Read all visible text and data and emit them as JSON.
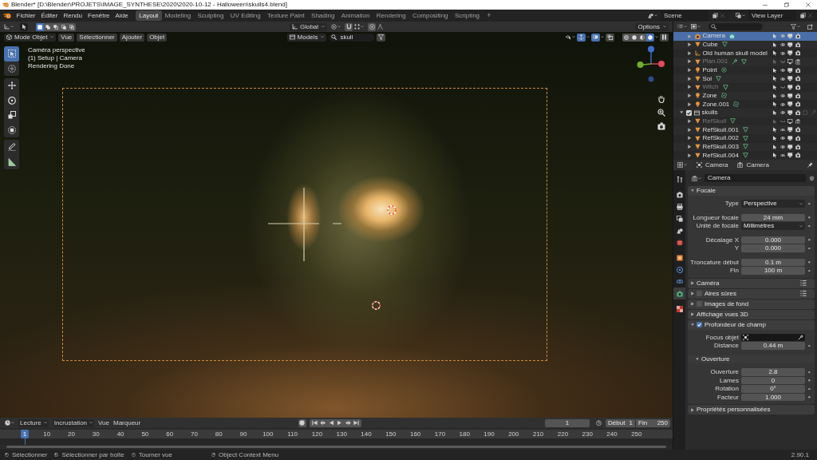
{
  "window": {
    "title": "Blender* [D:\\Blender\\PROJETS\\IMAGE_SYNTHESE\\2020\\2020-10-12 - Halloween\\skulls4.blend]"
  },
  "topbar": {
    "menus": [
      "Fichier",
      "Éditer",
      "Rendu",
      "Fenêtre",
      "Aide"
    ],
    "workspaces": [
      {
        "label": "Layout",
        "selected": true
      },
      {
        "label": "Modeling",
        "selected": false
      },
      {
        "label": "Sculpting",
        "selected": false
      },
      {
        "label": "UV Editing",
        "selected": false
      },
      {
        "label": "Texture Paint",
        "selected": false
      },
      {
        "label": "Shading",
        "selected": false
      },
      {
        "label": "Animation",
        "selected": false
      },
      {
        "label": "Rendering",
        "selected": false
      },
      {
        "label": "Compositing",
        "selected": false
      },
      {
        "label": "Scripting",
        "selected": false
      }
    ],
    "add_workspace": "+",
    "scene": "Scene",
    "view_layer": "View Layer"
  },
  "viewport": {
    "select_modes": [
      {
        "selected": true
      },
      {
        "selected": false
      },
      {
        "selected": false
      },
      {
        "selected": false
      },
      {
        "selected": false
      }
    ],
    "orientation": "Global",
    "options": "Options",
    "mode": "Mode Objet",
    "menus": [
      "Vue",
      "Sélectionner",
      "Ajouter",
      "Objet"
    ],
    "collection": "Models",
    "search": "skull",
    "toggles": [
      {
        "kind": "gizmo",
        "on": true
      },
      {
        "kind": "overlay",
        "on": true
      },
      {
        "kind": "xray",
        "on": false
      }
    ],
    "shading": [
      {
        "kind": "wireframe",
        "selected": false
      },
      {
        "kind": "solid",
        "selected": false
      },
      {
        "kind": "material",
        "selected": false
      },
      {
        "kind": "rendered",
        "selected": true
      }
    ],
    "info": [
      "Caméra perspective",
      "(1) Setup | Camera",
      "Rendering Done"
    ],
    "tool_groups": [
      [
        {
          "kind": "select",
          "selected": true
        },
        {
          "kind": "cursor",
          "selected": false
        }
      ],
      [
        {
          "kind": "move",
          "selected": false
        },
        {
          "kind": "rotate",
          "selected": false
        },
        {
          "kind": "scale",
          "selected": false
        },
        {
          "kind": "transform",
          "selected": false
        }
      ],
      [
        {
          "kind": "annotate",
          "selected": false
        },
        {
          "kind": "measure",
          "selected": false
        }
      ]
    ]
  },
  "outliner": {
    "objects": [
      {
        "name": "Camera",
        "kind": "camera",
        "selected": true,
        "expanded": false,
        "visible": true,
        "viewport": true,
        "render": true,
        "modifier": false
      },
      {
        "name": "Cube",
        "kind": "mesh",
        "selected": false,
        "expanded": false,
        "visible": true,
        "viewport": true,
        "render": true,
        "modifier": false
      },
      {
        "name": "Old human skull model",
        "kind": "empty",
        "selected": false,
        "expanded": false,
        "visible": true,
        "viewport": true,
        "render": true,
        "modifier": false
      },
      {
        "name": "Plan.001",
        "kind": "mesh",
        "selected": false,
        "expanded": false,
        "visible": false,
        "viewport": false,
        "render": false,
        "modifier": true
      },
      {
        "name": "Point",
        "kind": "point_light",
        "selected": false,
        "expanded": false,
        "visible": true,
        "viewport": true,
        "render": true,
        "modifier": false
      },
      {
        "name": "Sol",
        "kind": "mesh",
        "selected": false,
        "expanded": false,
        "visible": true,
        "viewport": true,
        "render": true,
        "modifier": false
      },
      {
        "name": "Witch",
        "kind": "mesh",
        "selected": false,
        "expanded": false,
        "visible": false,
        "viewport": true,
        "render": true,
        "modifier": false
      },
      {
        "name": "Zone",
        "kind": "area_light",
        "selected": false,
        "expanded": false,
        "visible": true,
        "viewport": true,
        "render": true,
        "modifier": false
      },
      {
        "name": "Zone.001",
        "kind": "area_light",
        "selected": false,
        "expanded": false,
        "visible": true,
        "viewport": true,
        "render": true,
        "modifier": false
      }
    ],
    "collections": [
      {
        "name": "skulls",
        "kind": "collection",
        "checked": true,
        "selected": false,
        "expanded": true,
        "visible": true,
        "viewport": true,
        "render": true,
        "children": [
          {
            "name": "RefSkull",
            "kind": "mesh",
            "selected": false,
            "expanded": false,
            "visible": false,
            "viewport": false,
            "render": false,
            "modifier": false
          },
          {
            "name": "RefSkull.001",
            "kind": "mesh",
            "selected": false,
            "expanded": false,
            "visible": true,
            "viewport": true,
            "render": true,
            "modifier": false
          },
          {
            "name": "RefSkull.002",
            "kind": "mesh",
            "selected": false,
            "expanded": false,
            "visible": true,
            "viewport": true,
            "render": true,
            "modifier": false
          },
          {
            "name": "RefSkull.003",
            "kind": "mesh",
            "selected": false,
            "expanded": false,
            "visible": true,
            "viewport": true,
            "render": true,
            "modifier": false
          },
          {
            "name": "RefSkull.004",
            "kind": "mesh",
            "selected": false,
            "expanded": false,
            "visible": true,
            "viewport": true,
            "render": true,
            "modifier": false
          }
        ]
      }
    ]
  },
  "properties": {
    "breadcrumb": [
      "Camera",
      "Camera"
    ],
    "tab_groups": [
      [
        {
          "kind": "tool",
          "selected": false
        }
      ],
      [
        {
          "kind": "render",
          "selected": false
        },
        {
          "kind": "output",
          "selected": false
        },
        {
          "kind": "view_layer",
          "selected": false
        },
        {
          "kind": "scene",
          "selected": false
        },
        {
          "kind": "world",
          "selected": false
        }
      ],
      [
        {
          "kind": "object",
          "selected": false
        },
        {
          "kind": "physics",
          "selected": false
        },
        {
          "kind": "constraints",
          "selected": false
        },
        {
          "kind": "camera_data",
          "selected": true
        }
      ],
      [
        {
          "kind": "texture",
          "selected": false
        }
      ]
    ],
    "datablock": "Camera",
    "panels": [
      {
        "label": "Focale",
        "kind": "plain",
        "expanded": true,
        "presets": false,
        "groups": [
          [
            {
              "label": "Type",
              "kind": "dropdown",
              "value": "Perspective"
            }
          ],
          [
            {
              "label": "Longueur focale",
              "kind": "number",
              "value": "24 mm"
            },
            {
              "label": "Unité de focale",
              "kind": "dropdown",
              "value": "Millimètres"
            }
          ],
          [
            {
              "label": "Décalage X",
              "kind": "number",
              "value": "0.000"
            },
            {
              "label": "Y",
              "kind": "number",
              "value": "0.000"
            }
          ],
          [
            {
              "label": "Troncature début",
              "kind": "number",
              "value": "0.1 m"
            },
            {
              "label": "Fin",
              "kind": "number",
              "value": "100 m"
            }
          ]
        ]
      },
      {
        "label": "Caméra",
        "kind": "plain",
        "expanded": false,
        "presets": true
      },
      {
        "label": "Aires sûres",
        "kind": "toggle",
        "checked": false,
        "expanded": false,
        "presets": true
      },
      {
        "label": "Images de fond",
        "kind": "toggle",
        "checked": false,
        "expanded": false,
        "presets": false
      },
      {
        "label": "Affichage vues 3D",
        "kind": "plain",
        "expanded": false,
        "presets": false
      },
      {
        "label": "Profondeur de champ",
        "kind": "toggle",
        "checked": true,
        "expanded": true,
        "presets": false,
        "groups": [
          [
            {
              "label": "Focus objet",
              "kind": "object"
            },
            {
              "label": "Distance",
              "kind": "number",
              "value": "0.44 m"
            }
          ]
        ],
        "subpanels": [
          {
            "label": "Ouverture",
            "expanded": true,
            "groups": [
              [
                {
                  "label": "Ouverture",
                  "kind": "number",
                  "value": "2.8"
                },
                {
                  "label": "Lames",
                  "kind": "number",
                  "value": "0"
                },
                {
                  "label": "Rotation",
                  "kind": "number",
                  "value": "0°"
                },
                {
                  "label": "Facteur",
                  "kind": "number",
                  "value": "1.000"
                }
              ]
            ]
          }
        ]
      },
      {
        "label": "Propriétés personnalisées",
        "kind": "plain",
        "expanded": false,
        "presets": false
      }
    ]
  },
  "timeline": {
    "menus": [
      {
        "label": "Lecture",
        "kind": "dropdown"
      },
      {
        "label": "Incrustation",
        "kind": "dropdown"
      },
      {
        "label": "Vue",
        "kind": "menu"
      },
      {
        "label": "Marqueur",
        "kind": "menu"
      }
    ],
    "current_frame": "1",
    "start": {
      "label": "Début",
      "value": "1"
    },
    "end": {
      "label": "Fin",
      "value": "250"
    },
    "frames": [
      {
        "label": "1",
        "current": true
      },
      {
        "label": "10",
        "current": false
      },
      {
        "label": "20",
        "current": false
      },
      {
        "label": "30",
        "current": false
      },
      {
        "label": "40",
        "current": false
      },
      {
        "label": "50",
        "current": false
      },
      {
        "label": "60",
        "current": false
      },
      {
        "label": "70",
        "current": false
      },
      {
        "label": "80",
        "current": false
      },
      {
        "label": "90",
        "current": false
      },
      {
        "label": "100",
        "current": false
      },
      {
        "label": "110",
        "current": false
      },
      {
        "label": "120",
        "current": false
      },
      {
        "label": "130",
        "current": false
      },
      {
        "label": "140",
        "current": false
      },
      {
        "label": "150",
        "current": false
      },
      {
        "label": "160",
        "current": false
      },
      {
        "label": "170",
        "current": false
      },
      {
        "label": "180",
        "current": false
      },
      {
        "label": "190",
        "current": false
      },
      {
        "label": "200",
        "current": false
      },
      {
        "label": "210",
        "current": false
      },
      {
        "label": "220",
        "current": false
      },
      {
        "label": "230",
        "current": false
      },
      {
        "label": "240",
        "current": false
      },
      {
        "label": "250",
        "current": false
      }
    ]
  },
  "statusbar": {
    "hints": [
      {
        "label": "Sélectionner",
        "kind": "left"
      },
      {
        "label": "Sélectionner par boîte",
        "kind": "left_drag"
      },
      {
        "label": "Tourner vue",
        "kind": "middle"
      },
      {
        "label": "Object Context Menu",
        "kind": "right"
      }
    ],
    "version": "2.90.1"
  }
}
